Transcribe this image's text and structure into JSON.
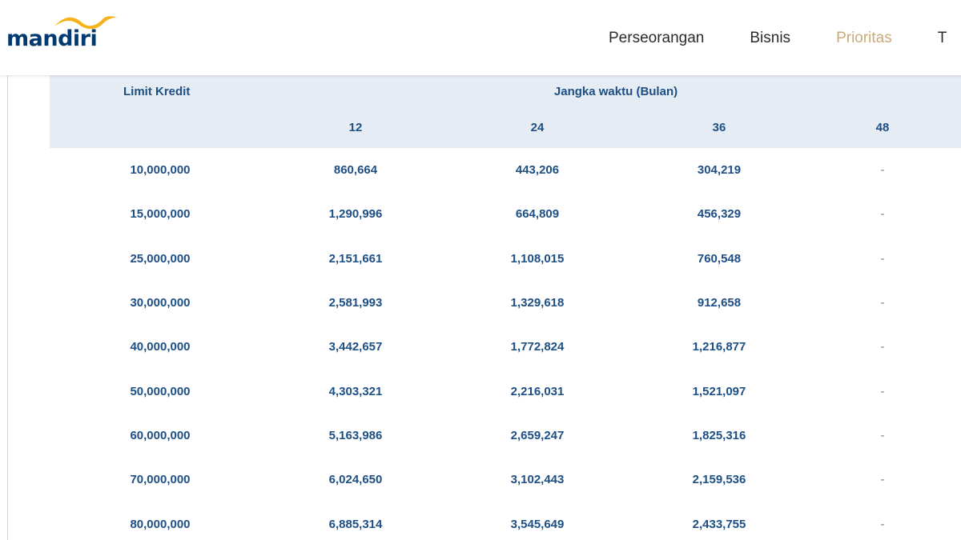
{
  "brand": {
    "name": "mandiri",
    "wing_color": "#f5b21a",
    "text_color": "#003a70"
  },
  "nav": {
    "items": [
      {
        "label": "Perseorangan",
        "active": false
      },
      {
        "label": "Bisnis",
        "active": false
      },
      {
        "label": "Prioritas",
        "active": true
      },
      {
        "label": "T",
        "active": false
      }
    ],
    "active_color": "#c9ab7b"
  },
  "table": {
    "limit_header": "Limit Kredit",
    "term_header": "Jangka waktu (Bulan)",
    "terms": [
      "12",
      "24",
      "36",
      "48"
    ],
    "header_bg": "#e6ecf3",
    "text_color": "#1d4f85",
    "rows": [
      {
        "limit": "10,000,000",
        "values": [
          "860,664",
          "443,206",
          "304,219",
          "-"
        ]
      },
      {
        "limit": "15,000,000",
        "values": [
          "1,290,996",
          "664,809",
          "456,329",
          "-"
        ]
      },
      {
        "limit": "25,000,000",
        "values": [
          "2,151,661",
          "1,108,015",
          "760,548",
          "-"
        ]
      },
      {
        "limit": "30,000,000",
        "values": [
          "2,581,993",
          "1,329,618",
          "912,658",
          "-"
        ]
      },
      {
        "limit": "40,000,000",
        "values": [
          "3,442,657",
          "1,772,824",
          "1,216,877",
          "-"
        ]
      },
      {
        "limit": "50,000,000",
        "values": [
          "4,303,321",
          "2,216,031",
          "1,521,097",
          "-"
        ]
      },
      {
        "limit": "60,000,000",
        "values": [
          "5,163,986",
          "2,659,247",
          "1,825,316",
          "-"
        ]
      },
      {
        "limit": "70,000,000",
        "values": [
          "6,024,650",
          "3,102,443",
          "2,159,536",
          "-"
        ]
      },
      {
        "limit": "80,000,000",
        "values": [
          "6,885,314",
          "3,545,649",
          "2,433,755",
          "-"
        ]
      }
    ]
  }
}
